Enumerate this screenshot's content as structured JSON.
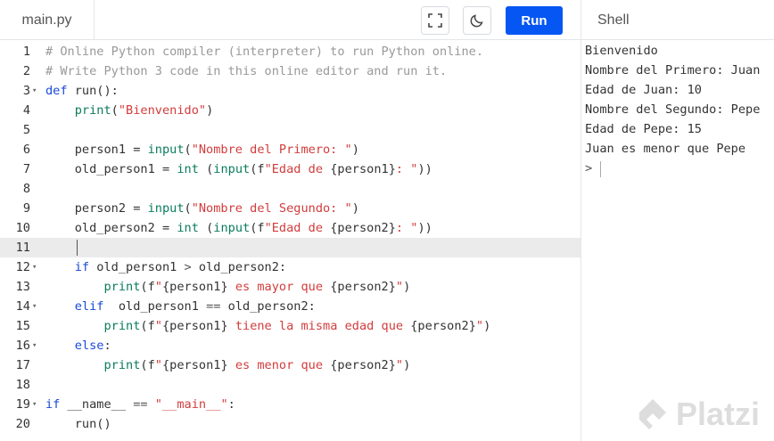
{
  "header": {
    "file_tab": "main.py",
    "run_label": "Run",
    "shell_title": "Shell",
    "icons": {
      "fullscreen": "expand-icon",
      "theme": "moon-icon"
    }
  },
  "editor": {
    "active_line": 11,
    "lines": [
      {
        "n": "1",
        "fold": "",
        "tokens": [
          [
            "com",
            "# Online Python compiler (interpreter) to run Python online."
          ]
        ]
      },
      {
        "n": "2",
        "fold": "",
        "tokens": [
          [
            "com",
            "# Write Python 3 code in this online editor and run it."
          ]
        ]
      },
      {
        "n": "3",
        "fold": "▾",
        "tokens": [
          [
            "kw",
            "def"
          ],
          [
            "",
            " run():"
          ]
        ]
      },
      {
        "n": "4",
        "fold": "",
        "tokens": [
          [
            "",
            "    "
          ],
          [
            "fn",
            "print"
          ],
          [
            "",
            "("
          ],
          [
            "str",
            "\"Bienvenido\""
          ],
          [
            "",
            ")"
          ]
        ]
      },
      {
        "n": "5",
        "fold": "",
        "tokens": []
      },
      {
        "n": "6",
        "fold": "",
        "tokens": [
          [
            "",
            "    person1 = "
          ],
          [
            "fn",
            "input"
          ],
          [
            "",
            "("
          ],
          [
            "str",
            "\"Nombre del Primero: \""
          ],
          [
            "",
            ")"
          ]
        ]
      },
      {
        "n": "7",
        "fold": "",
        "tokens": [
          [
            "",
            "    old_person1 = "
          ],
          [
            "fn",
            "int"
          ],
          [
            "",
            " ("
          ],
          [
            "fn",
            "input"
          ],
          [
            "",
            "(f"
          ],
          [
            "str",
            "\"Edad de "
          ],
          [
            "",
            "{person1}"
          ],
          [
            "str",
            ": \""
          ],
          [
            "",
            "))"
          ]
        ]
      },
      {
        "n": "8",
        "fold": "",
        "tokens": []
      },
      {
        "n": "9",
        "fold": "",
        "tokens": [
          [
            "",
            "    person2 = "
          ],
          [
            "fn",
            "input"
          ],
          [
            "",
            "("
          ],
          [
            "str",
            "\"Nombre del Segundo: \""
          ],
          [
            "",
            ")"
          ]
        ]
      },
      {
        "n": "10",
        "fold": "",
        "tokens": [
          [
            "",
            "    old_person2 = "
          ],
          [
            "fn",
            "int"
          ],
          [
            "",
            " ("
          ],
          [
            "fn",
            "input"
          ],
          [
            "",
            "(f"
          ],
          [
            "str",
            "\"Edad de "
          ],
          [
            "",
            "{person2}"
          ],
          [
            "str",
            ": \""
          ],
          [
            "",
            "))"
          ]
        ]
      },
      {
        "n": "11",
        "fold": "",
        "tokens": []
      },
      {
        "n": "12",
        "fold": "▾",
        "tokens": [
          [
            "",
            "    "
          ],
          [
            "kw",
            "if"
          ],
          [
            "",
            " old_person1 "
          ],
          [
            "op",
            ">"
          ],
          [
            "",
            " old_person2:"
          ]
        ]
      },
      {
        "n": "13",
        "fold": "",
        "tokens": [
          [
            "",
            "        "
          ],
          [
            "fn",
            "print"
          ],
          [
            "",
            "(f"
          ],
          [
            "str",
            "\""
          ],
          [
            "",
            "{person1}"
          ],
          [
            "str",
            " es mayor que "
          ],
          [
            "",
            "{person2}"
          ],
          [
            "str",
            "\""
          ],
          [
            "",
            ")"
          ]
        ]
      },
      {
        "n": "14",
        "fold": "▾",
        "tokens": [
          [
            "",
            "    "
          ],
          [
            "kw",
            "elif"
          ],
          [
            "",
            "  old_person1 "
          ],
          [
            "op",
            "=="
          ],
          [
            "",
            " old_person2:"
          ]
        ]
      },
      {
        "n": "15",
        "fold": "",
        "tokens": [
          [
            "",
            "        "
          ],
          [
            "fn",
            "print"
          ],
          [
            "",
            "(f"
          ],
          [
            "str",
            "\""
          ],
          [
            "",
            "{person1}"
          ],
          [
            "str",
            " tiene la misma edad que "
          ],
          [
            "",
            "{person2}"
          ],
          [
            "str",
            "\""
          ],
          [
            "",
            ")"
          ]
        ]
      },
      {
        "n": "16",
        "fold": "▾",
        "tokens": [
          [
            "",
            "    "
          ],
          [
            "kw",
            "else"
          ],
          [
            "",
            ":"
          ]
        ]
      },
      {
        "n": "17",
        "fold": "",
        "tokens": [
          [
            "",
            "        "
          ],
          [
            "fn",
            "print"
          ],
          [
            "",
            "(f"
          ],
          [
            "str",
            "\""
          ],
          [
            "",
            "{person1}"
          ],
          [
            "str",
            " es menor que "
          ],
          [
            "",
            "{person2}"
          ],
          [
            "str",
            "\""
          ],
          [
            "",
            ")"
          ]
        ]
      },
      {
        "n": "18",
        "fold": "",
        "tokens": []
      },
      {
        "n": "19",
        "fold": "▾",
        "tokens": [
          [
            "kw",
            "if"
          ],
          [
            "",
            " __name__ "
          ],
          [
            "op",
            "=="
          ],
          [
            "",
            " "
          ],
          [
            "str",
            "\"__main__\""
          ],
          [
            "",
            ":"
          ]
        ]
      },
      {
        "n": "20",
        "fold": "",
        "tokens": [
          [
            "",
            "    run()"
          ]
        ]
      }
    ]
  },
  "shell": {
    "output": [
      "Bienvenido",
      "Nombre del Primero: Juan",
      "Edad de Juan: 10",
      "Nombre del Segundo: Pepe",
      "Edad de Pepe: 15",
      "Juan es menor que Pepe"
    ],
    "prompt": ">"
  },
  "watermark": {
    "text": "Platzi",
    "icon": "platzi-logo-icon"
  }
}
